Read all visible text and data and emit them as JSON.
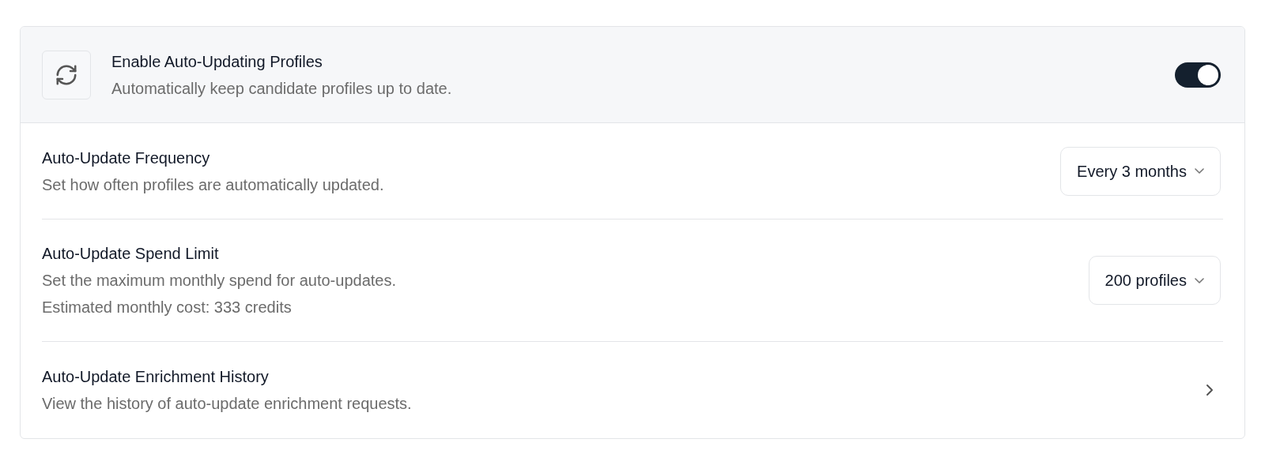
{
  "header": {
    "title": "Enable Auto-Updating Profiles",
    "description": "Automatically keep candidate profiles up to date.",
    "on": true
  },
  "settings": [
    {
      "kind": "select",
      "title": "Auto-Update Frequency",
      "lines": [
        "Set how often profiles are automatically updated."
      ],
      "value": "Every 3 months"
    },
    {
      "kind": "select",
      "title": "Auto-Update Spend Limit",
      "lines": [
        "Set the maximum monthly spend for auto-updates.",
        "Estimated monthly cost: 333 credits"
      ],
      "value": "200 profiles"
    },
    {
      "kind": "link",
      "title": "Auto-Update Enrichment History",
      "lines": [
        "View the history of auto-update enrichment requests."
      ]
    }
  ]
}
